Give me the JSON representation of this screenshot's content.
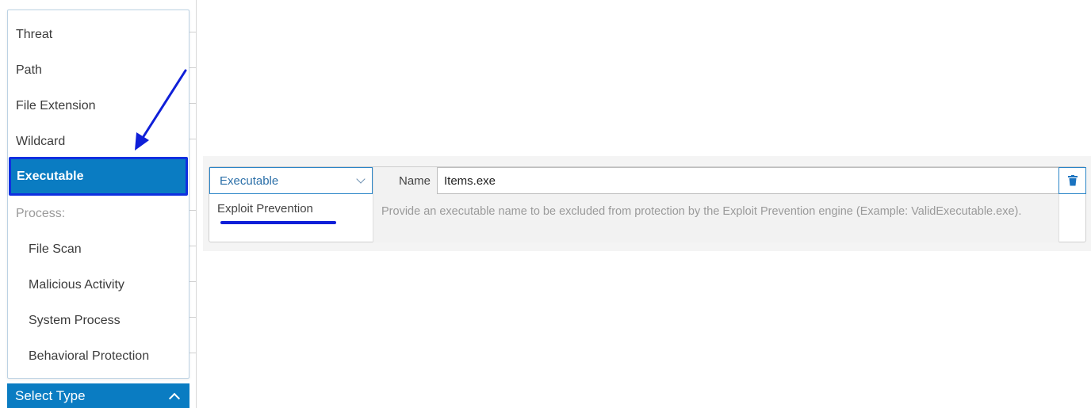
{
  "dropdown": {
    "items": [
      {
        "label": "Threat",
        "kind": "option"
      },
      {
        "label": "Path",
        "kind": "option"
      },
      {
        "label": "File Extension",
        "kind": "option"
      },
      {
        "label": "Wildcard",
        "kind": "option"
      },
      {
        "label": "Executable",
        "kind": "selected"
      },
      {
        "label": "Process:",
        "kind": "header"
      },
      {
        "label": "File Scan",
        "kind": "sub"
      },
      {
        "label": "Malicious Activity",
        "kind": "sub"
      },
      {
        "label": "System Process",
        "kind": "sub"
      },
      {
        "label": "Behavioral Protection",
        "kind": "sub"
      }
    ],
    "button_label": "Select Type"
  },
  "exclusion": {
    "type_value": "Executable",
    "type_caption": "Exploit Prevention",
    "name_label": "Name",
    "name_value": "Items.exe",
    "help_text": "Provide an executable name to be excluded from protection by the Exploit Prevention engine (Example: ValidExecutable.exe)."
  },
  "colors": {
    "accent": "#0a7cc2",
    "annotation": "#0f1fd8",
    "border_blue": "#2b85c7"
  },
  "icons": {
    "select_chevron": "chevron-up-icon",
    "type_chevron": "chevron-down-icon",
    "delete": "trash-icon"
  }
}
